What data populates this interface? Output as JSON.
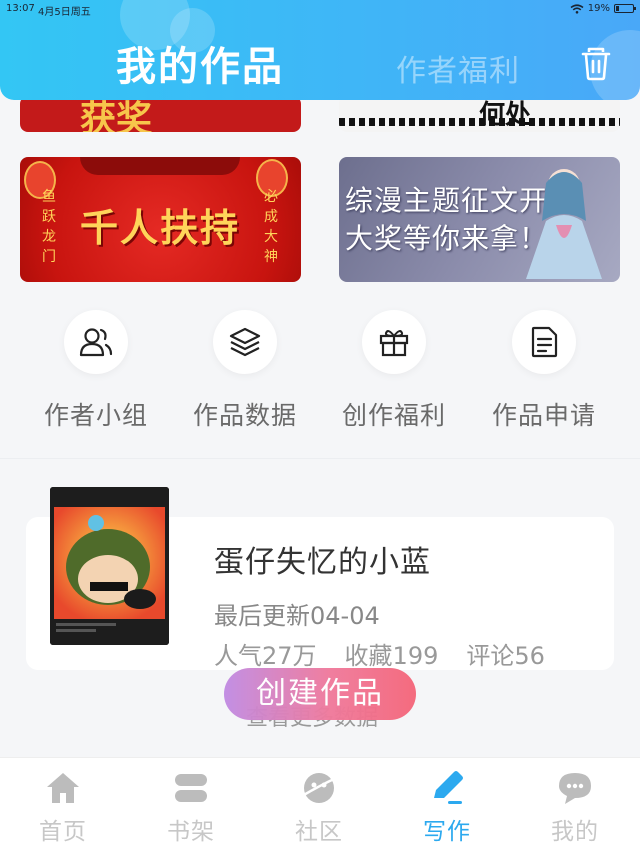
{
  "status_bar": {
    "time": "13:07",
    "date": "4月5日周五",
    "battery": "19%",
    "battery_level": 0.19
  },
  "header": {
    "tab_active": "我的作品",
    "tab_inactive": "作者福利"
  },
  "banners": {
    "top_left_text": "获奖",
    "top_right_text": "何处",
    "left_title": "千人扶持",
    "left_side_left": "鱼跃龙门",
    "left_side_right": "必成大神",
    "right_line1": "综漫主题征文开启",
    "right_line2": "大奖等你来拿！"
  },
  "entries": [
    {
      "label": "作者小组",
      "icon": "users-icon"
    },
    {
      "label": "作品数据",
      "icon": "layers-icon"
    },
    {
      "label": "创作福利",
      "icon": "gift-icon"
    },
    {
      "label": "作品申请",
      "icon": "document-icon"
    }
  ],
  "work": {
    "title": "蛋仔失忆的小蓝",
    "updated": "最后更新04-04",
    "popularity": "人气27万",
    "favorites": "收藏199",
    "comments": "评论56"
  },
  "more_data": "查看更多数据",
  "create_button": "创建作品",
  "nav": [
    {
      "label": "首页",
      "icon": "home-icon"
    },
    {
      "label": "书架",
      "icon": "bookshelf-icon"
    },
    {
      "label": "社区",
      "icon": "planet-icon"
    },
    {
      "label": "写作",
      "icon": "pen-icon",
      "active": true
    },
    {
      "label": "我的",
      "icon": "chat-icon"
    }
  ],
  "colors": {
    "header_start": "#33c6f4",
    "header_end": "#49a8f8",
    "nav_active": "#2ca9ef",
    "create_start": "#c08be3",
    "create_end": "#f4667a"
  }
}
